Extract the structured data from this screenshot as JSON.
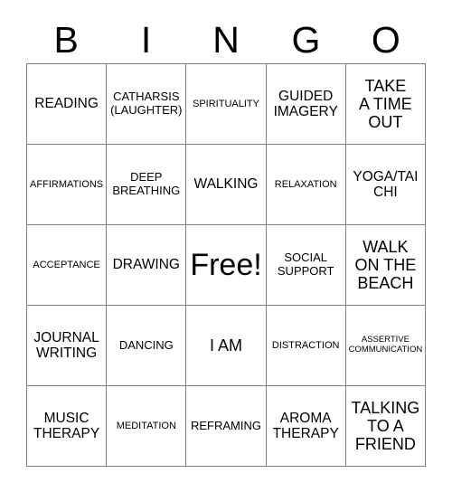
{
  "header": {
    "letters": [
      "B",
      "I",
      "N",
      "G",
      "O"
    ]
  },
  "grid": {
    "rows": 5,
    "columns": 5,
    "border_color": "#808080",
    "background_color": "#ffffff",
    "text_color": "#000000",
    "cells": [
      {
        "text": "READING",
        "size": "l"
      },
      {
        "text": "CATHARSIS\n(LAUGHTER)",
        "size": "m"
      },
      {
        "text": "SPIRITUALITY",
        "size": "s"
      },
      {
        "text": "GUIDED\nIMAGERY",
        "size": "l"
      },
      {
        "text": "TAKE\nA TIME\nOUT",
        "size": "xl"
      },
      {
        "text": "AFFIRMATIONS",
        "size": "s"
      },
      {
        "text": "DEEP\nBREATHING",
        "size": "m"
      },
      {
        "text": "WALKING",
        "size": "l"
      },
      {
        "text": "RELAXATION",
        "size": "s"
      },
      {
        "text": "YOGA/TAI\nCHI",
        "size": "l"
      },
      {
        "text": "ACCEPTANCE",
        "size": "s"
      },
      {
        "text": "DRAWING",
        "size": "l"
      },
      {
        "text": "Free!",
        "size": "free"
      },
      {
        "text": "SOCIAL\nSUPPORT",
        "size": "m"
      },
      {
        "text": "WALK\nON THE\nBEACH",
        "size": "xl"
      },
      {
        "text": "JOURNAL\nWRITING",
        "size": "l"
      },
      {
        "text": "DANCING",
        "size": "m"
      },
      {
        "text": "I AM",
        "size": "xl"
      },
      {
        "text": "DISTRACTION",
        "size": "s"
      },
      {
        "text": "ASSERTIVE\nCOMMUNICATION",
        "size": "xs"
      },
      {
        "text": "MUSIC\nTHERAPY",
        "size": "l"
      },
      {
        "text": "MEDITATION",
        "size": "s"
      },
      {
        "text": "REFRAMING",
        "size": "m"
      },
      {
        "text": "AROMA\nTHERAPY",
        "size": "l"
      },
      {
        "text": "TALKING\nTO A\nFRIEND",
        "size": "xl"
      }
    ]
  }
}
